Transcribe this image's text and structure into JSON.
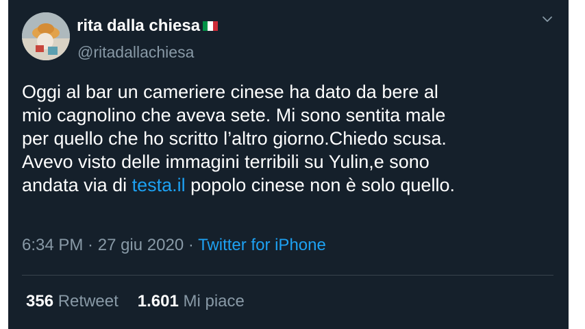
{
  "tweet": {
    "author_name": "rita dalla chiesa",
    "author_handle": "@ritadallachiesa",
    "flag_colors": [
      "#009246",
      "#ffffff",
      "#ce2b37"
    ],
    "text_lines": [
      "Oggi al bar un cameriere cinese ha dato da bere al",
      "mio cagnolino che aveva sete. Mi sono sentita male",
      "per quello che ho scritto l’altro giorno.Chiedo scusa.",
      "Avevo visto delle immagini terribili su Yulin,e sono"
    ],
    "last_line_before": "andata via di ",
    "last_line_link": "testa.il",
    "last_line_after": " popolo cinese non è solo quello.",
    "time": "6:34 PM",
    "separator": " · ",
    "date": "27 giu 2020",
    "source": "Twitter for iPhone",
    "retweet_count": "356",
    "retweet_label": "Retweet",
    "like_count": "1.601",
    "like_label": "Mi piace"
  },
  "colors": {
    "background": "#15202b",
    "text": "#ffffff",
    "secondary": "#8899a6",
    "accent": "#1da1f2"
  },
  "icons": {
    "menu": "chevron-down-icon"
  }
}
